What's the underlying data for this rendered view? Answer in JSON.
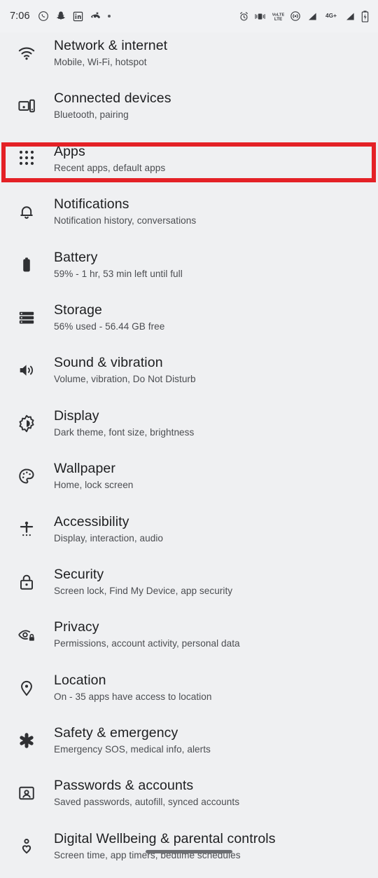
{
  "status_bar": {
    "clock": "7:06",
    "left_icons": [
      {
        "name": "whatsapp-icon",
        "label": "WhatsApp"
      },
      {
        "name": "snapchat-icon",
        "label": "Snapchat"
      },
      {
        "name": "linkedin-icon",
        "label": "LinkedIn"
      },
      {
        "name": "missed-call-icon",
        "label": "Missed call"
      },
      {
        "name": "more-notifications-dot-icon",
        "label": "More notifications"
      }
    ],
    "right_icons": [
      {
        "name": "alarm-icon",
        "label": "Alarm set"
      },
      {
        "name": "vibrate-icon",
        "label": "Ringer vibrate"
      },
      {
        "name": "volte-icon",
        "label": "VoLTE"
      },
      {
        "name": "hotspot-icon",
        "label": "Hotspot"
      },
      {
        "name": "signal-sim1-icon",
        "label": "Signal SIM 1"
      },
      {
        "name": "network-type-icon",
        "label": "4G+"
      },
      {
        "name": "signal-sim2-icon",
        "label": "Signal SIM 2"
      },
      {
        "name": "battery-charging-icon",
        "label": "Battery charging"
      }
    ],
    "network_type_text": "4G+",
    "volte_text_top": "VoLTE",
    "volte_text_bottom": "LTE"
  },
  "highlight": {
    "color": "#e42126",
    "target": "Apps"
  },
  "settings_list": [
    {
      "id": "network-internet",
      "icon": "wifi-icon",
      "title": "Network & internet",
      "subtitle": "Mobile, Wi-Fi, hotspot"
    },
    {
      "id": "connected-devices",
      "icon": "connected-devices-icon",
      "title": "Connected devices",
      "subtitle": "Bluetooth, pairing"
    },
    {
      "id": "apps",
      "icon": "apps-grid-icon",
      "title": "Apps",
      "subtitle": "Recent apps, default apps"
    },
    {
      "id": "notifications",
      "icon": "bell-icon",
      "title": "Notifications",
      "subtitle": "Notification history, conversations"
    },
    {
      "id": "battery",
      "icon": "battery-icon",
      "title": "Battery",
      "subtitle": "59% - 1 hr, 53 min left until full"
    },
    {
      "id": "storage",
      "icon": "storage-icon",
      "title": "Storage",
      "subtitle": "56% used - 56.44 GB free"
    },
    {
      "id": "sound-vibration",
      "icon": "sound-icon",
      "title": "Sound & vibration",
      "subtitle": "Volume, vibration, Do Not Disturb"
    },
    {
      "id": "display",
      "icon": "brightness-icon",
      "title": "Display",
      "subtitle": "Dark theme, font size, brightness"
    },
    {
      "id": "wallpaper",
      "icon": "palette-icon",
      "title": "Wallpaper",
      "subtitle": "Home, lock screen"
    },
    {
      "id": "accessibility",
      "icon": "accessibility-icon",
      "title": "Accessibility",
      "subtitle": "Display, interaction, audio"
    },
    {
      "id": "security",
      "icon": "lock-icon",
      "title": "Security",
      "subtitle": "Screen lock, Find My Device, app security"
    },
    {
      "id": "privacy",
      "icon": "eye-lock-icon",
      "title": "Privacy",
      "subtitle": "Permissions, account activity, personal data"
    },
    {
      "id": "location",
      "icon": "location-pin-icon",
      "title": "Location",
      "subtitle": "On - 35 apps have access to location"
    },
    {
      "id": "safety-emergency",
      "icon": "star-of-life-icon",
      "title": "Safety & emergency",
      "subtitle": "Emergency SOS, medical info, alerts"
    },
    {
      "id": "passwords-accounts",
      "icon": "account-card-icon",
      "title": "Passwords & accounts",
      "subtitle": "Saved passwords, autofill, synced accounts"
    },
    {
      "id": "digital-wellbeing",
      "icon": "wellbeing-icon",
      "title": "Digital Wellbeing & parental controls",
      "subtitle": "Screen time, app timers, bedtime schedules"
    }
  ]
}
